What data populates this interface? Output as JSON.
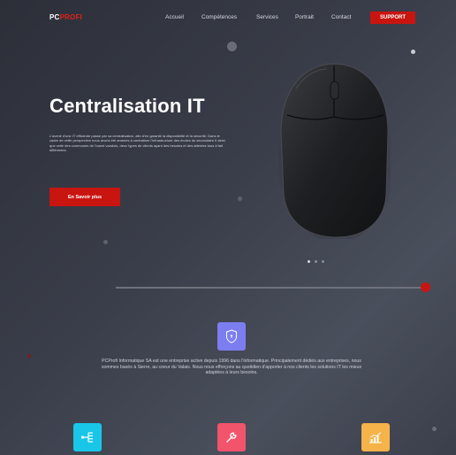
{
  "brand": {
    "part1": "PC",
    "part2": "PROFI"
  },
  "nav": {
    "items": [
      "Accueil",
      "Compétences",
      "Services",
      "Portrait",
      "Contact"
    ],
    "support_label": "SUPPORT"
  },
  "hero": {
    "title": "Centralisation IT",
    "text": "L'avenir d'une IT efficiente passe par sa centralisation, afin d'en garantir la disponibilité et la sécurité. Dans le cadre de cette perspective nous avons été amenés à centraliser l'infrastructure des écoles du secondaire II ainsi que celle des communes de l'ouest vaudois, deux types de clients ayant des besoins et des attentes tous à fait différentes.",
    "cta_label": "En Savoir plus",
    "slides": 3,
    "active_slide": 0
  },
  "about": {
    "text": "PCProfi Informatique SA est une entreprise active depuis 1996 dans l'informatique. Principalement dédiés aux entreprises, nous sommes basés à Sierre, au coeur du Valais. Nous nous efforçons au quotidien d'apporter à nos clients les solutions IT les mieux adaptées à leurs besoins."
  },
  "icons": {
    "feature": "shield-icon",
    "services": [
      "network-icon",
      "wrench-icon",
      "chart-icon"
    ]
  },
  "colors": {
    "accent": "#c91510",
    "feature_bg": "#7c7ef0",
    "service_1": "#19c6e8",
    "service_2": "#f1546b",
    "service_3": "#f5b34a"
  }
}
